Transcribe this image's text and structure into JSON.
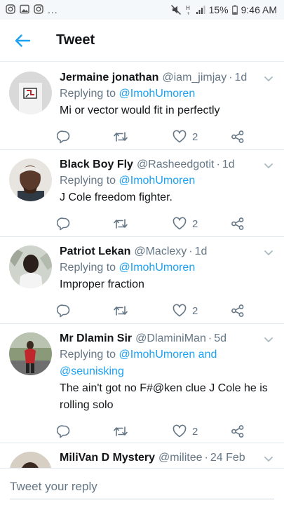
{
  "status_bar": {
    "battery": "15%",
    "time": "9:46 AM",
    "more": "..."
  },
  "header": {
    "title": "Tweet"
  },
  "tweets": [
    {
      "name": "Jermaine jonathan",
      "handle": "@iam_jimjay",
      "time": "1d",
      "replying_prefix": "Replying to ",
      "mentions": "@ImohUmoren",
      "text": "Mi or vector would fit in perfectly",
      "likes": "2"
    },
    {
      "name": "Black Boy Fly",
      "handle": "@Rasheedgotit",
      "time": "1d",
      "replying_prefix": "Replying to ",
      "mentions": "@ImohUmoren",
      "text": "J Cole freedom fighter.",
      "likes": "2"
    },
    {
      "name": "Patriot Lekan",
      "handle": "@Maclexy",
      "time": "1d",
      "replying_prefix": "Replying to ",
      "mentions": "@ImohUmoren",
      "text": "Improper fraction",
      "likes": "2"
    },
    {
      "name": "Mr Dlamin Sir",
      "handle": "@DlaminiMan",
      "time": "5d",
      "replying_prefix": "Replying to ",
      "mentions": "@ImohUmoren and @seunisking",
      "text": "The ain't got no F#@ken clue J Cole he is rolling solo",
      "likes": "2"
    },
    {
      "name": "MiliVan D Mystery",
      "handle": "@militee",
      "time": "24 Feb"
    }
  ],
  "compose": {
    "placeholder": "Tweet your reply"
  },
  "colors": {
    "accent": "#1da1f2",
    "secondary_text": "#657786",
    "divider": "#e1e8ed"
  }
}
